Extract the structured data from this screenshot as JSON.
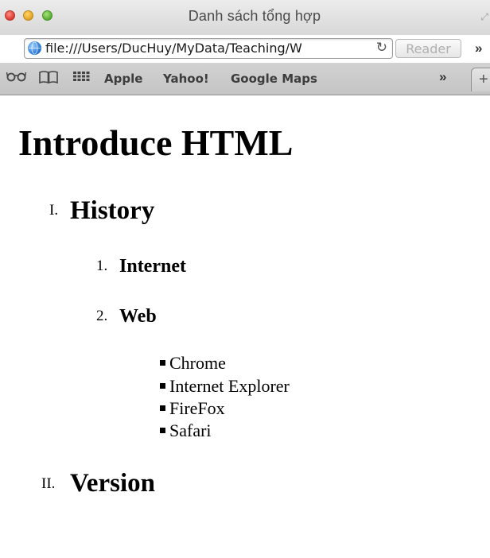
{
  "window": {
    "title": "Danh sách tổng hợp"
  },
  "toolbar": {
    "url": "file:///Users/DucHuy/MyData/Teaching/W",
    "reader_label": "Reader"
  },
  "bookmarks": {
    "items": [
      {
        "label": "Apple"
      },
      {
        "label": "Yahoo!"
      },
      {
        "label": "Google Maps"
      }
    ]
  },
  "page": {
    "heading": "Introduce HTML",
    "sections": [
      {
        "marker": "I.",
        "title": "History",
        "subsections": [
          {
            "marker": "1.",
            "title": "Internet"
          },
          {
            "marker": "2.",
            "title": "Web",
            "items": [
              "Chrome",
              "Internet Explorer",
              "FireFox",
              "Safari"
            ]
          }
        ]
      },
      {
        "marker": "II.",
        "title": "Version"
      }
    ]
  }
}
